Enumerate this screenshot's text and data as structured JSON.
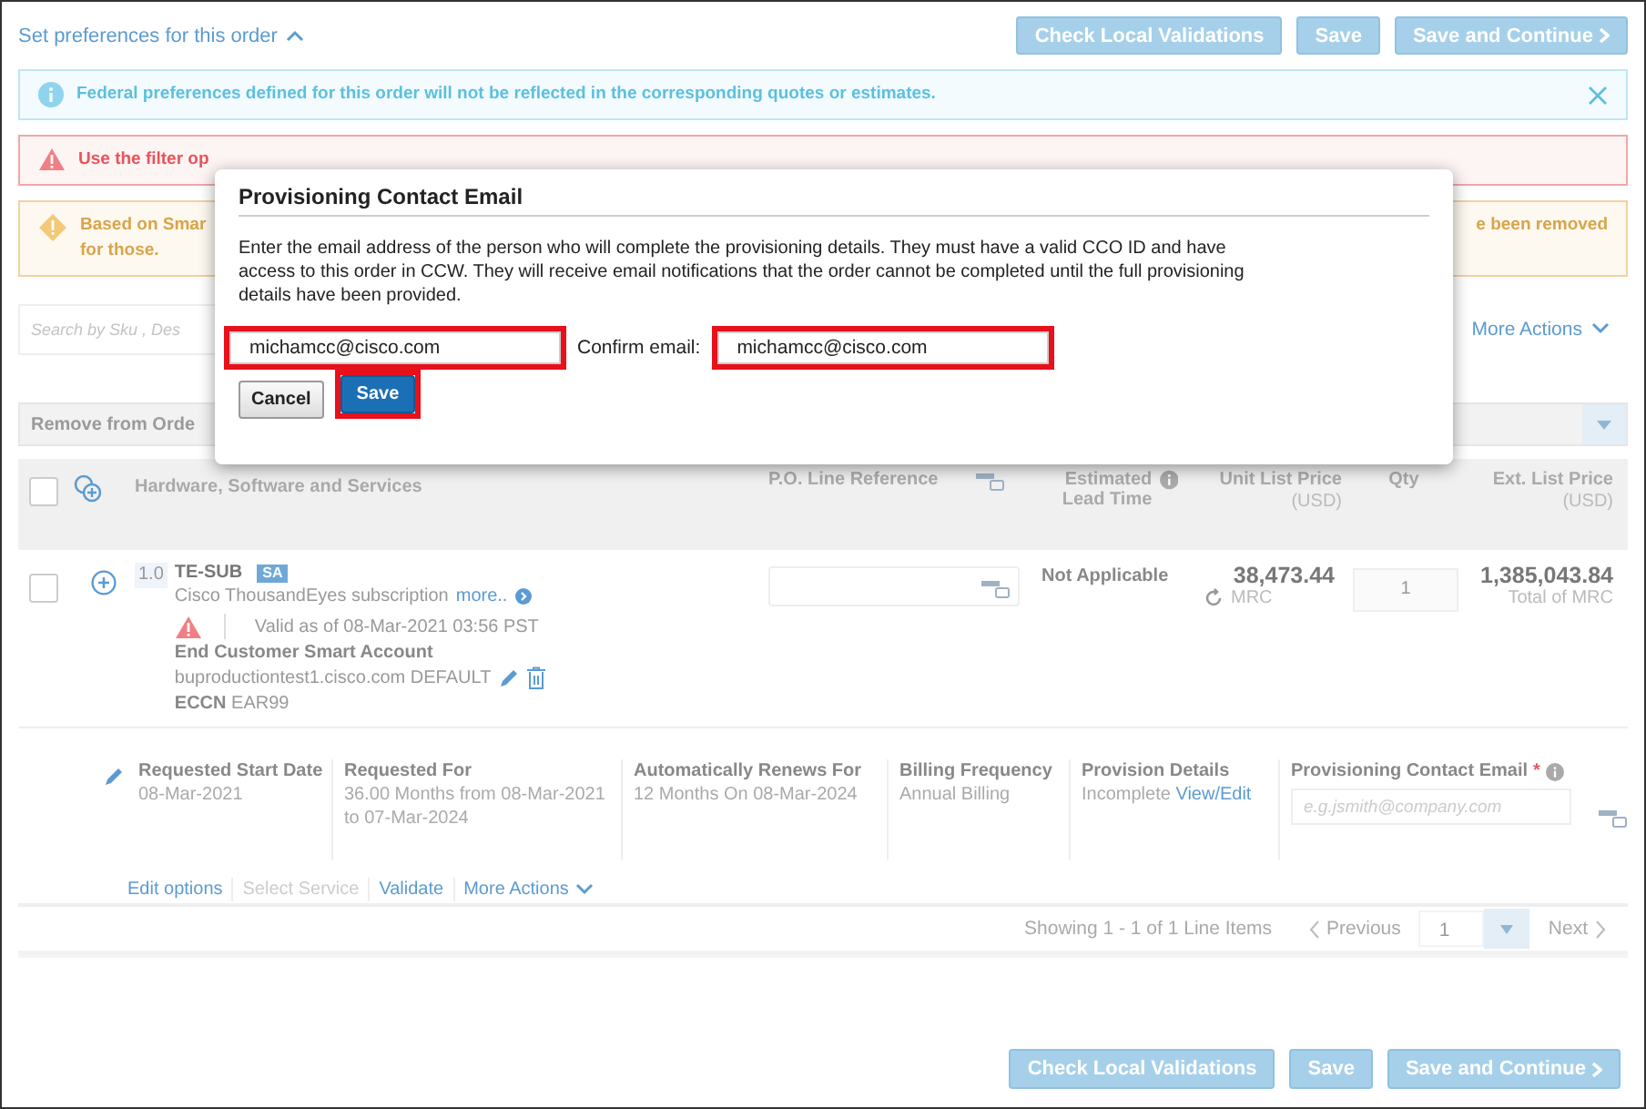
{
  "header": {
    "title": "Set preferences for this order",
    "expanded": true,
    "buttons": [
      {
        "label": "Check Local Validations",
        "kind": "plain"
      },
      {
        "label": "Save",
        "kind": "plain"
      },
      {
        "label": "Save and Continue",
        "kind": "next"
      }
    ]
  },
  "alerts": [
    {
      "kind": "info",
      "dismissible": true,
      "lines": [
        {
          "left": "Federal preferences defined for this order will not be reflected in the corresponding quotes or estimates."
        }
      ]
    },
    {
      "kind": "error",
      "dismissible": false,
      "lines": [
        {
          "left": "Use the filter op"
        }
      ]
    },
    {
      "kind": "warning",
      "dismissible": false,
      "lines": [
        {
          "left": "Based on Smar",
          "right": "e been removed"
        },
        {
          "left": "for those."
        }
      ]
    }
  ],
  "search": {
    "placeholder": "Search by Sku , Des",
    "more_actions": "More Actions"
  },
  "toolbar": {
    "remove_label": "Remove from Orde"
  },
  "table": {
    "select_all": false,
    "columns": [
      {
        "label": "Hardware, Software and Services",
        "kind": "product"
      },
      {
        "label": "P.O. Line Reference",
        "kind": "po"
      },
      {
        "label": "Estimated Lead Time",
        "kind": "info"
      },
      {
        "label": "Unit List Price",
        "sub": "(USD)",
        "kind": "money"
      },
      {
        "label": "Qty",
        "kind": "qty"
      },
      {
        "label": "Ext. List Price",
        "sub": "(USD)",
        "kind": "money"
      }
    ],
    "item": {
      "selected": false,
      "line": "1.0",
      "sku": "TE-SUB",
      "badge": "SA",
      "description": "Cisco ThousandEyes subscription",
      "more": "more..",
      "validity": "Valid as of 08-Mar-2021 03:56 PST",
      "account_heading": "End Customer Smart Account",
      "account": "buproductiontest1.cisco.com DEFAULT",
      "eccn_label": "ECCN",
      "eccn": "EAR99",
      "lead_time": "Not Applicable",
      "unit_price": "38,473.44",
      "unit_note": "MRC",
      "qty": "1",
      "ext_price": "1,385,043.84",
      "ext_note": "Total of MRC"
    },
    "details": [
      {
        "label": "Requested Start Date",
        "value": "08-Mar-2021"
      },
      {
        "label": "Requested For",
        "value": "36.00 Months from 08-Mar-2021 to 07-Mar-2024"
      },
      {
        "label": "Automatically Renews For",
        "value": "12 Months On 08-Mar-2024"
      },
      {
        "label": "Billing Frequency",
        "value": "Annual Billing"
      },
      {
        "label": "Provision Details",
        "value": "Incomplete",
        "link": "View/Edit"
      }
    ],
    "contact_email": {
      "label": "Provisioning Contact Email",
      "required": true,
      "required_mark": "*",
      "placeholder": "e.g.jsmith@company.com"
    },
    "actions": [
      {
        "label": "Edit options",
        "kind": "link",
        "disabled": false
      },
      {
        "label": "Select Service",
        "kind": "link",
        "disabled": true
      },
      {
        "label": "Validate",
        "kind": "link",
        "disabled": false
      },
      {
        "label": "More Actions",
        "kind": "menu",
        "disabled": false
      }
    ]
  },
  "pager": {
    "summary": "Showing 1 - 1 of 1 Line Items",
    "previous": "Previous",
    "page": "1",
    "next": "Next"
  },
  "footer": {
    "buttons": [
      {
        "label": "Check Local Validations",
        "kind": "plain"
      },
      {
        "label": "Save",
        "kind": "plain"
      },
      {
        "label": "Save and Continue",
        "kind": "next"
      }
    ]
  },
  "modal": {
    "title": "Provisioning Contact Email",
    "message": "Enter the email address of the person who will complete the provisioning details. They must have a valid CCO ID and have access to this order in CCW. They will receive email notifications that the order cannot be completed until the full provisioning details have been provided.",
    "email": {
      "value": "michamcc@cisco.com",
      "highlighted": true
    },
    "confirm_label": "Confirm email:",
    "confirm": {
      "value": "michamcc@cisco.com",
      "highlighted": true
    },
    "buttons": [
      {
        "label": "Cancel",
        "kind": "secondary",
        "highlighted": false
      },
      {
        "label": "Save",
        "kind": "primary",
        "highlighted": true
      }
    ]
  }
}
